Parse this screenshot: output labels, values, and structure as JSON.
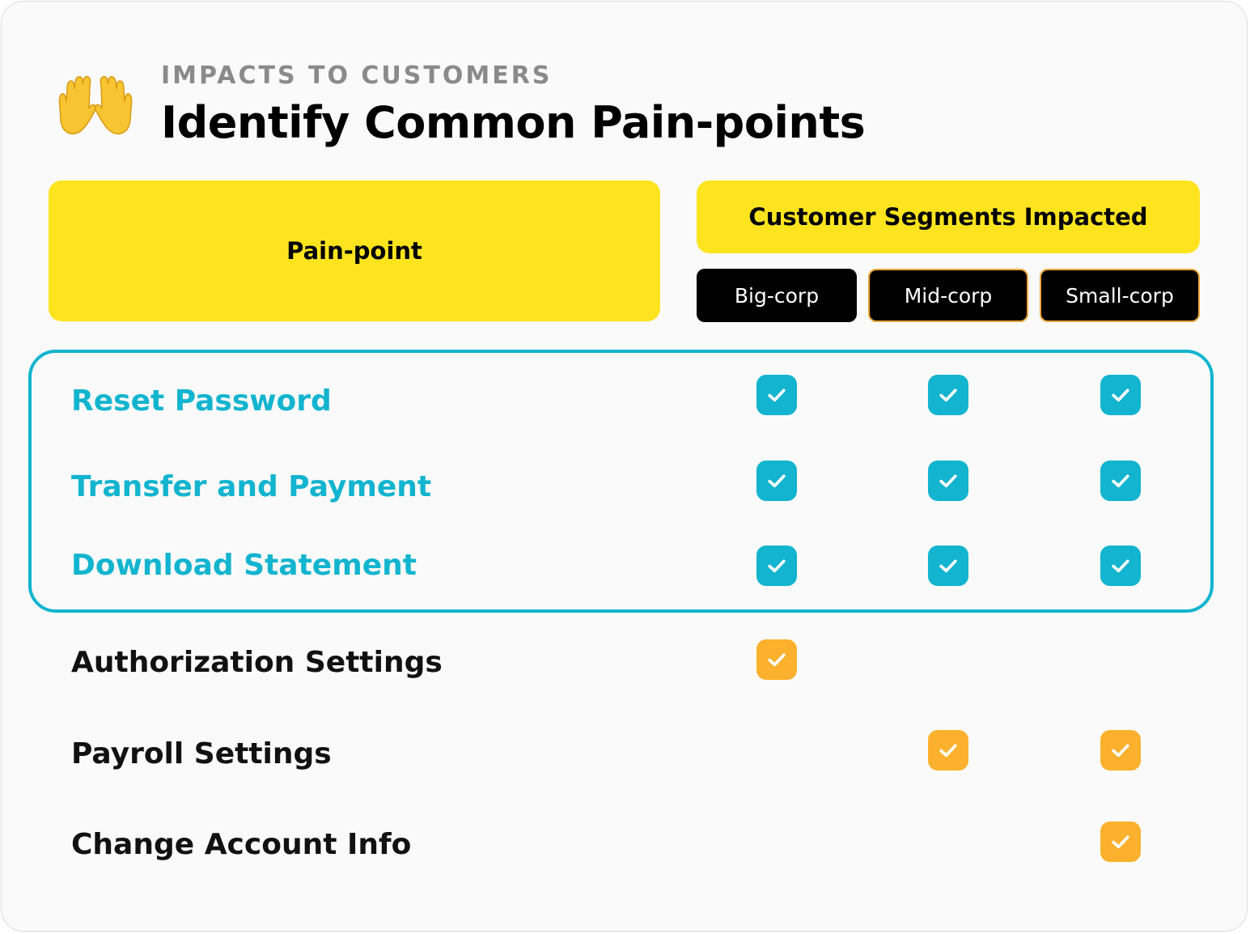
{
  "header": {
    "eyebrow": "IMPACTS TO CUSTOMERS",
    "title": "Identify Common Pain-points",
    "icon": "open-hands-icon"
  },
  "table": {
    "pain_point_header": "Pain-point",
    "segments_header": "Customer Segments Impacted",
    "segments": [
      "Big-corp",
      "Mid-corp",
      "Small-corp"
    ],
    "rows": [
      {
        "label": "Reset Password",
        "highlighted": true,
        "impacts": [
          true,
          true,
          true
        ]
      },
      {
        "label": "Transfer and Payment",
        "highlighted": true,
        "impacts": [
          true,
          true,
          true
        ]
      },
      {
        "label": "Download Statement",
        "highlighted": true,
        "impacts": [
          true,
          true,
          true
        ]
      },
      {
        "label": "Authorization Settings",
        "highlighted": false,
        "impacts": [
          true,
          false,
          false
        ]
      },
      {
        "label": "Payroll Settings",
        "highlighted": false,
        "impacts": [
          false,
          true,
          true
        ]
      },
      {
        "label": "Change Account Info",
        "highlighted": false,
        "impacts": [
          false,
          false,
          true
        ]
      }
    ]
  },
  "colors": {
    "accent_yellow": "#fde41f",
    "highlight_teal": "#12b4cf",
    "check_orange": "#fbb12d",
    "chip_black": "#000000"
  }
}
